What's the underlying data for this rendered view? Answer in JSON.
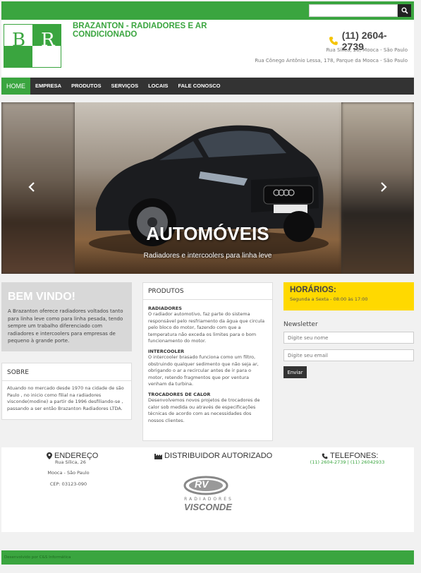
{
  "search": {
    "placeholder": "",
    "button_icon": "search-icon"
  },
  "header": {
    "logo_letters": [
      "B",
      "R"
    ],
    "company_name": "BRAZANTON - RADIADORES E AR CONDICIONADO",
    "phone": "(11) 2604-2739",
    "address_1": "Rua Sílica, 26, Mooca - São Paulo",
    "address_2": "Rua Cônego Antônio Lessa, 178, Parque da Mooca - São Paulo",
    "accent_color": "#3aa53f",
    "phone_icon_color": "#f5c400"
  },
  "nav": {
    "items": [
      {
        "label": "HOME"
      },
      {
        "label": "EMPRESA"
      },
      {
        "label": "PRODUTOS"
      },
      {
        "label": "SERVIÇOS"
      },
      {
        "label": "LOCAIS"
      },
      {
        "label": "FALE CONOSCO"
      }
    ]
  },
  "slider": {
    "title": "AUTOMÓVEIS",
    "subtitle": "Radiadores e intercoolers para linha leve",
    "prev_icon": "chevron-left-icon",
    "next_icon": "chevron-right-icon"
  },
  "welcome": {
    "title": "BEM VINDO!",
    "text": "A Brazanton oferece radiadores voltados tanto para linha leve como para linha pesada, tendo sempre um trabalho diferenciado com radiadores e intercoolers para empresas de pequeno à grande porte."
  },
  "about": {
    "title": "SOBRE",
    "text": "Atuando no mercado desde 1970 na cidade de são Paulo , no inicio como filial na radiadores visconde(modine) a partir de 1996 desfiliando-se , passando a ser então Brazanton Radiadores LTDA."
  },
  "products": {
    "title": "PRODUTOS",
    "items": [
      {
        "heading": "RADIADORES",
        "text": "O radiador automotivo, faz parte do sistema responsável pelo resfriamento da água que circula pelo bloco do motor, fazendo com que a temperatura não exceda os limites para o bom funcionamento do motor."
      },
      {
        "heading": "INTERCOOLER",
        "text": "O intercooler brasado funciona como um filtro, obstruindo qualquer sedimento que não seja ar, obrigando o ar a recircular antes de ir para o motor, retendo fragmentos que por ventura venham da turbina."
      },
      {
        "heading": "TROCADORES DE CALOR",
        "text": "Desenvolvemos novos projetos de trocadores de calor sob medida ou através de especificações técnicas de acordo com as necessidades dos nossos clientes."
      }
    ]
  },
  "hours": {
    "title": "HORÁRIOS:",
    "text": "Segunda a Sexta - 08:00 às 17:00",
    "color": "#ffd900"
  },
  "newsletter": {
    "label": "Newsletter",
    "name_placeholder": "Digite seu nome",
    "email_placeholder": "Digite seu email",
    "send_label": "Enviar"
  },
  "footer": {
    "address_title": "ENDEREÇO",
    "address_lines": [
      "Rua Sílica, 26",
      "Mooca - São Paulo",
      "CEP: 03123-090"
    ],
    "distributor_title": "DISTRIBUIDOR AUTORIZADO",
    "distributor_logo": {
      "mark": "RV",
      "line1": "RADIADORES",
      "line2": "VISCONDE"
    },
    "phones_title": "TELEFONES:",
    "phones_text": "(11) 2604-2739 | (11) 26042933",
    "credit": "Desenvolvido por C&S Informática"
  }
}
